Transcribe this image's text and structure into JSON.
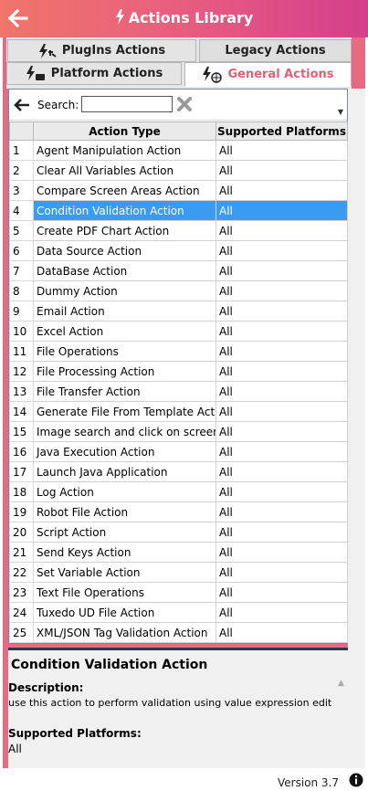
{
  "header": {
    "title": "Actions Library",
    "brand_color": "#e8607e"
  },
  "tabs": {
    "plugins": "PlugIns Actions",
    "legacy": "Legacy Actions",
    "platform": "Platform Actions",
    "general": "General Actions",
    "active": "General Actions"
  },
  "toolbar": {
    "search_label": "Search:",
    "search_value": ""
  },
  "grid": {
    "columns": [
      "Action Type",
      "Supported Platforms"
    ],
    "selected_index": 4,
    "rows": [
      {
        "n": "1",
        "type": "Agent Manipulation Action",
        "platforms": "All"
      },
      {
        "n": "2",
        "type": "Clear All Variables Action",
        "platforms": "All"
      },
      {
        "n": "3",
        "type": "Compare Screen Areas Action",
        "platforms": "All"
      },
      {
        "n": "4",
        "type": "Condition Validation Action",
        "platforms": "All"
      },
      {
        "n": "5",
        "type": "Create PDF Chart Action",
        "platforms": "All"
      },
      {
        "n": "6",
        "type": "Data Source Action",
        "platforms": "All"
      },
      {
        "n": "7",
        "type": "DataBase Action",
        "platforms": "All"
      },
      {
        "n": "8",
        "type": "Dummy Action",
        "platforms": "All"
      },
      {
        "n": "9",
        "type": "Email Action",
        "platforms": "All"
      },
      {
        "n": "10",
        "type": "Excel Action",
        "platforms": "All"
      },
      {
        "n": "11",
        "type": "File Operations",
        "platforms": "All"
      },
      {
        "n": "12",
        "type": "File Processing Action",
        "platforms": "All"
      },
      {
        "n": "13",
        "type": "File Transfer Action",
        "platforms": "All"
      },
      {
        "n": "14",
        "type": "Generate File From Template Action",
        "platforms": "All"
      },
      {
        "n": "15",
        "type": "Image search and click on screen",
        "platforms": "All"
      },
      {
        "n": "16",
        "type": "Java Execution Action",
        "platforms": "All"
      },
      {
        "n": "17",
        "type": "Launch Java Application",
        "platforms": "All"
      },
      {
        "n": "18",
        "type": "Log Action",
        "platforms": "All"
      },
      {
        "n": "19",
        "type": "Robot File Action",
        "platforms": "All"
      },
      {
        "n": "20",
        "type": "Script Action",
        "platforms": "All"
      },
      {
        "n": "21",
        "type": "Send Keys Action",
        "platforms": "All"
      },
      {
        "n": "22",
        "type": "Set Variable Action",
        "platforms": "All"
      },
      {
        "n": "23",
        "type": "Text File Operations",
        "platforms": "All"
      },
      {
        "n": "24",
        "type": "Tuxedo UD File Action",
        "platforms": "All"
      },
      {
        "n": "25",
        "type": "XML/JSON Tag Validation Action",
        "platforms": "All"
      }
    ]
  },
  "details": {
    "title": "Condition Validation Action",
    "description_label": "Description:",
    "description": "use this action to perform validation using value expression edit",
    "platforms_label": "Supported Platforms:",
    "platforms": "All"
  },
  "footer": {
    "version": "Version 3.7"
  },
  "colors": {
    "selected_row": "#3b9bf0",
    "active_tab_text": "#e0607a"
  }
}
